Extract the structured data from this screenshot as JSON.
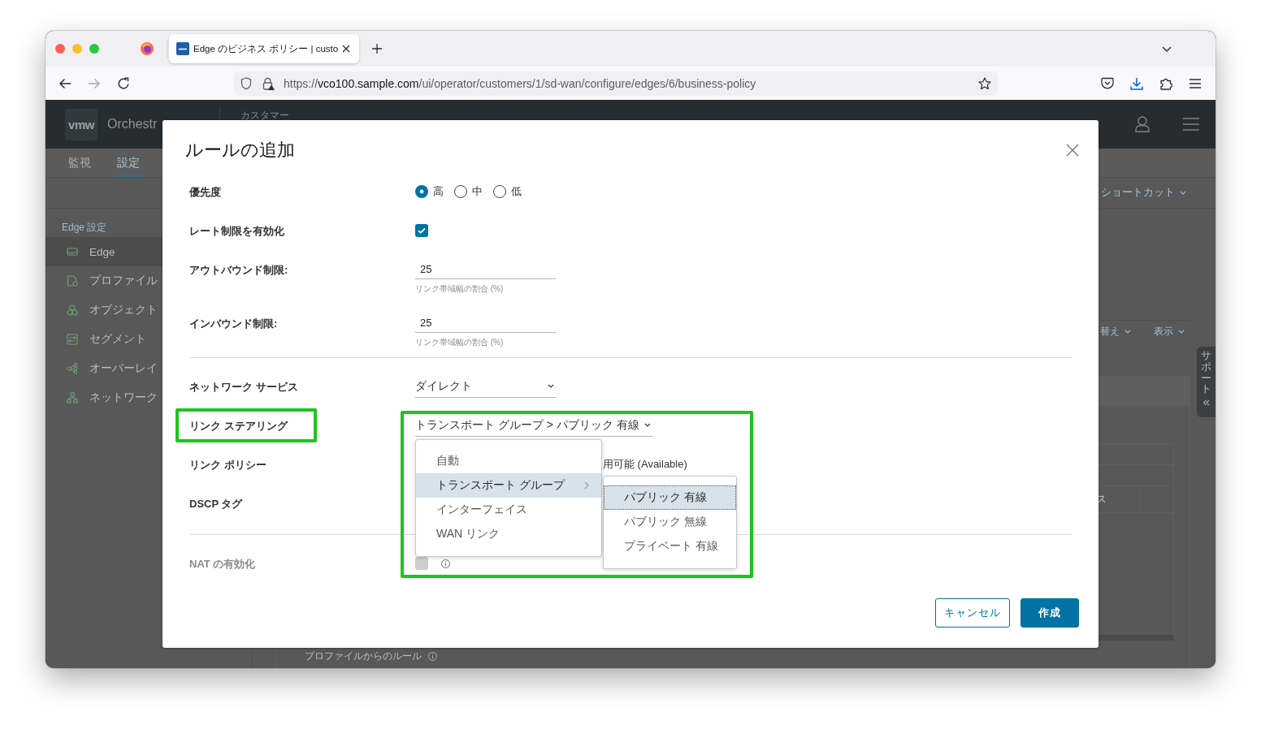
{
  "browser": {
    "tab": {
      "title": "Edge のビジネス ポリシー | custo"
    },
    "address": {
      "scheme": "https://",
      "host": "vco100.sample.com",
      "path": "/ui/operator/customers/1/sd-wan/configure/edges/6/business-policy"
    }
  },
  "app": {
    "header": {
      "logo": "vmw",
      "product": "Orchestr",
      "customer_label": "カスタマー"
    },
    "nav_tabs": [
      {
        "label": "監視",
        "selected": false
      },
      {
        "label": "設定",
        "selected": true
      }
    ],
    "shortcuts": "ショートカット",
    "sidebar": {
      "heading": "Edge 設定",
      "items": [
        {
          "label": "Edge",
          "selected": true
        },
        {
          "label": "プロファイル",
          "selected": false
        },
        {
          "label": "オブジェクト",
          "selected": false
        },
        {
          "label": "セグメント",
          "selected": false
        },
        {
          "label": "オーバーレイ",
          "selected": false
        },
        {
          "label": "ネットワーク",
          "selected": false
        }
      ]
    },
    "toolbar": [
      {
        "label": "替え"
      },
      {
        "label": "表示"
      }
    ],
    "table": {
      "header_cell": "ス"
    },
    "section_title": "プロファイルからのルール",
    "support_tab": "サポート"
  },
  "dialog": {
    "title": "ルールの追加",
    "sections": [
      {
        "fields": [
          {
            "kind": "radio",
            "label": "優先度",
            "options": [
              {
                "label": "高",
                "selected": true
              },
              {
                "label": "中",
                "selected": false
              },
              {
                "label": "低",
                "selected": false
              }
            ]
          },
          {
            "kind": "checkbox",
            "label": "レート制限を有効化",
            "checked": true,
            "disabled": false,
            "info": false
          },
          {
            "kind": "input",
            "label": "アウトバウンド制限:",
            "value": "25",
            "hint": "リンク帯域幅の割合 (%)"
          },
          {
            "kind": "input",
            "label": "インバウンド制限:",
            "value": "25",
            "hint": "リンク帯域幅の割合 (%)"
          }
        ]
      },
      {
        "fields": [
          {
            "kind": "select",
            "label": "ネットワーク サービス",
            "value": "ダイレクト"
          },
          {
            "kind": "select",
            "label": "リンク ステアリング",
            "highlighted": true,
            "value": "トランスポート グループ > パブリック 有線",
            "expanded": true,
            "options": [
              {
                "label": "自動",
                "selected": false
              },
              {
                "label": "トランスポート グループ",
                "selected": true,
                "expanded": true,
                "children": [
                  {
                    "label": "パブリック 有線",
                    "selected": true
                  },
                  {
                    "label": "パブリック 無線",
                    "selected": false
                  },
                  {
                    "label": "プライベート 有線",
                    "selected": false
                  }
                ]
              },
              {
                "label": "インターフェイス",
                "selected": false
              },
              {
                "label": "WAN リンク",
                "selected": false
              }
            ]
          },
          {
            "kind": "text",
            "label": "リンク ポリシー",
            "value": "用可能 (Available)"
          },
          {
            "kind": "text",
            "label": "DSCP タグ"
          }
        ]
      },
      {
        "fields": [
          {
            "kind": "checkbox",
            "label": "NAT の有効化",
            "checked": false,
            "disabled": true,
            "info": true
          }
        ]
      }
    ],
    "buttons": [
      {
        "label": "キャンセル",
        "kind": "secondary"
      },
      {
        "label": "作成",
        "kind": "primary"
      }
    ]
  }
}
